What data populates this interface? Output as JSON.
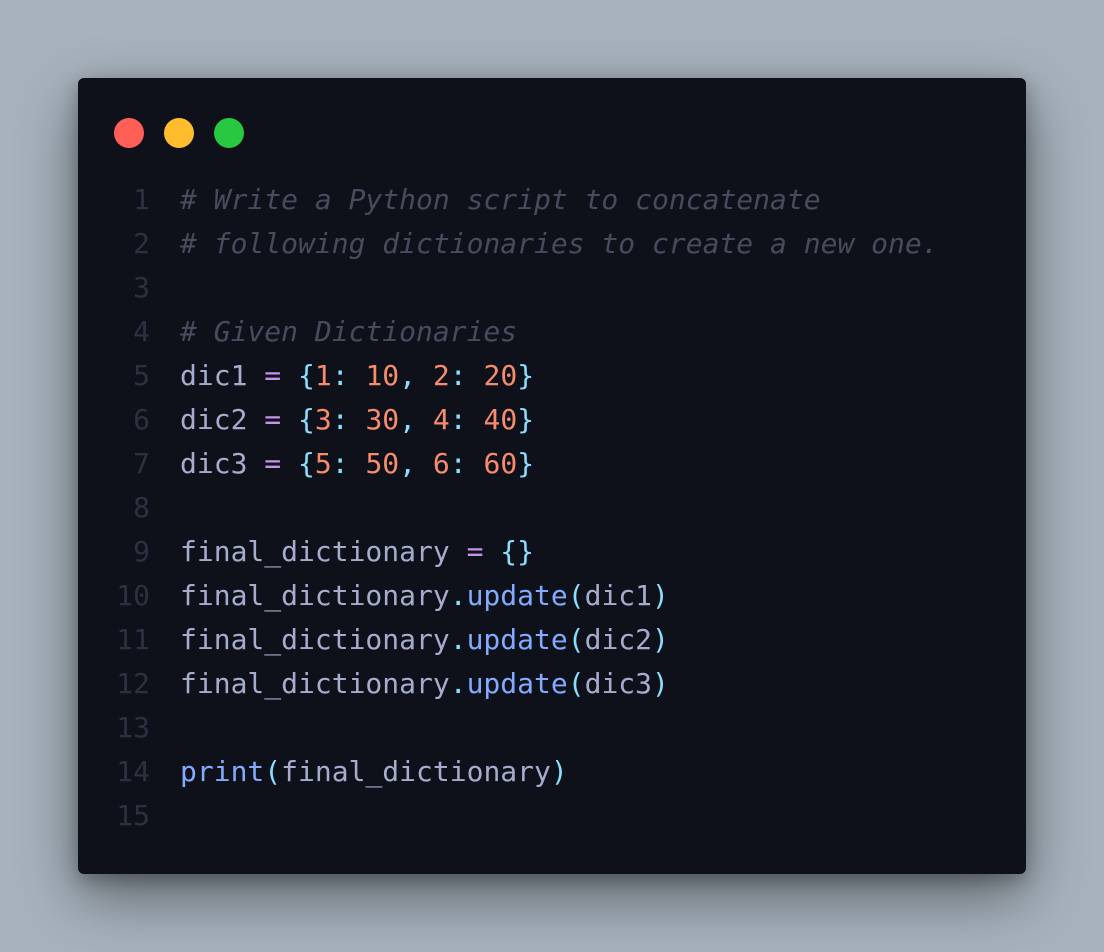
{
  "window": {
    "controls": [
      {
        "name": "close",
        "color": "#ff5f57"
      },
      {
        "name": "minimize",
        "color": "#ffbd2e"
      },
      {
        "name": "maximize",
        "color": "#28c840"
      }
    ]
  },
  "colors": {
    "background": "#a7b2bd",
    "editor_background": "#0f111a",
    "line_number": "#2c3040",
    "text": "#a6accd",
    "comment": "#464b5d",
    "operator": "#c792ea",
    "brace": "#89ddff",
    "number": "#f78c6c",
    "function": "#82aaff"
  },
  "code": {
    "lines": [
      {
        "number": "1",
        "tokens": [
          {
            "t": "comment",
            "v": "# Write a Python script to concatenate"
          }
        ]
      },
      {
        "number": "2",
        "tokens": [
          {
            "t": "comment",
            "v": "# following dictionaries to create a new one."
          }
        ]
      },
      {
        "number": "3",
        "tokens": []
      },
      {
        "number": "4",
        "tokens": [
          {
            "t": "comment",
            "v": "# Given Dictionaries"
          }
        ]
      },
      {
        "number": "5",
        "tokens": [
          {
            "t": "ident",
            "v": "dic1 "
          },
          {
            "t": "op",
            "v": "="
          },
          {
            "t": "ident",
            "v": " "
          },
          {
            "t": "brace",
            "v": "{"
          },
          {
            "t": "num",
            "v": "1"
          },
          {
            "t": "punct",
            "v": ": "
          },
          {
            "t": "num",
            "v": "10"
          },
          {
            "t": "punct",
            "v": ", "
          },
          {
            "t": "num",
            "v": "2"
          },
          {
            "t": "punct",
            "v": ": "
          },
          {
            "t": "num",
            "v": "20"
          },
          {
            "t": "brace",
            "v": "}"
          }
        ]
      },
      {
        "number": "6",
        "tokens": [
          {
            "t": "ident",
            "v": "dic2 "
          },
          {
            "t": "op",
            "v": "="
          },
          {
            "t": "ident",
            "v": " "
          },
          {
            "t": "brace",
            "v": "{"
          },
          {
            "t": "num",
            "v": "3"
          },
          {
            "t": "punct",
            "v": ": "
          },
          {
            "t": "num",
            "v": "30"
          },
          {
            "t": "punct",
            "v": ", "
          },
          {
            "t": "num",
            "v": "4"
          },
          {
            "t": "punct",
            "v": ": "
          },
          {
            "t": "num",
            "v": "40"
          },
          {
            "t": "brace",
            "v": "}"
          }
        ]
      },
      {
        "number": "7",
        "tokens": [
          {
            "t": "ident",
            "v": "dic3 "
          },
          {
            "t": "op",
            "v": "="
          },
          {
            "t": "ident",
            "v": " "
          },
          {
            "t": "brace",
            "v": "{"
          },
          {
            "t": "num",
            "v": "5"
          },
          {
            "t": "punct",
            "v": ": "
          },
          {
            "t": "num",
            "v": "50"
          },
          {
            "t": "punct",
            "v": ", "
          },
          {
            "t": "num",
            "v": "6"
          },
          {
            "t": "punct",
            "v": ": "
          },
          {
            "t": "num",
            "v": "60"
          },
          {
            "t": "brace",
            "v": "}"
          }
        ]
      },
      {
        "number": "8",
        "tokens": []
      },
      {
        "number": "9",
        "tokens": [
          {
            "t": "ident",
            "v": "final_dictionary "
          },
          {
            "t": "op",
            "v": "="
          },
          {
            "t": "ident",
            "v": " "
          },
          {
            "t": "brace",
            "v": "{}"
          }
        ]
      },
      {
        "number": "10",
        "tokens": [
          {
            "t": "ident",
            "v": "final_dictionary"
          },
          {
            "t": "punct",
            "v": "."
          },
          {
            "t": "fn",
            "v": "update"
          },
          {
            "t": "brace",
            "v": "("
          },
          {
            "t": "ident",
            "v": "dic1"
          },
          {
            "t": "brace",
            "v": ")"
          }
        ]
      },
      {
        "number": "11",
        "tokens": [
          {
            "t": "ident",
            "v": "final_dictionary"
          },
          {
            "t": "punct",
            "v": "."
          },
          {
            "t": "fn",
            "v": "update"
          },
          {
            "t": "brace",
            "v": "("
          },
          {
            "t": "ident",
            "v": "dic2"
          },
          {
            "t": "brace",
            "v": ")"
          }
        ]
      },
      {
        "number": "12",
        "tokens": [
          {
            "t": "ident",
            "v": "final_dictionary"
          },
          {
            "t": "punct",
            "v": "."
          },
          {
            "t": "fn",
            "v": "update"
          },
          {
            "t": "brace",
            "v": "("
          },
          {
            "t": "ident",
            "v": "dic3"
          },
          {
            "t": "brace",
            "v": ")"
          }
        ]
      },
      {
        "number": "13",
        "tokens": []
      },
      {
        "number": "14",
        "tokens": [
          {
            "t": "fn",
            "v": "print"
          },
          {
            "t": "brace",
            "v": "("
          },
          {
            "t": "ident",
            "v": "final_dictionary"
          },
          {
            "t": "brace",
            "v": ")"
          }
        ]
      },
      {
        "number": "15",
        "tokens": []
      }
    ]
  }
}
